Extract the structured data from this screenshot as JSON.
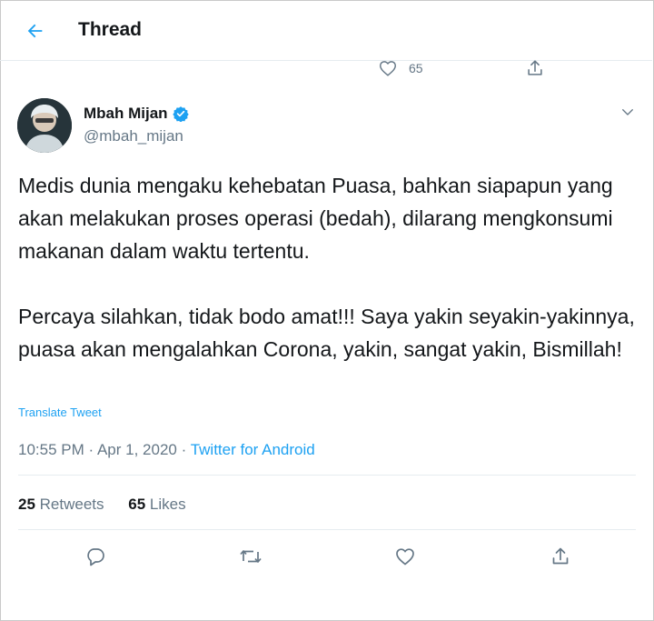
{
  "header": {
    "title": "Thread"
  },
  "previous_tweet": {
    "like_count": "65"
  },
  "tweet": {
    "author_name": "Mbah Mijan",
    "author_handle": "@mbah_mijan",
    "paragraphs": [
      "Medis dunia mengaku kehebatan Puasa, bahkan siapapun yang akan melakukan proses operasi (bedah), dilarang mengkonsumi makanan dalam waktu tertentu.",
      "Percaya silahkan, tidak bodo amat!!! Saya yakin seyakin-yakinnya, puasa akan mengalahkan Corona, yakin, sangat yakin, Bismillah!"
    ],
    "translate_label": "Translate Tweet",
    "time": "10:55 PM",
    "date": "Apr 1, 2020",
    "separator": "·",
    "source": "Twitter for Android",
    "retweet_count": "25",
    "retweet_label": "Retweets",
    "like_count": "65",
    "like_label": "Likes"
  },
  "colors": {
    "accent": "#1da1f2",
    "text": "#14171a",
    "muted": "#657786",
    "divider": "#e6ecf0"
  },
  "icons": [
    "back-arrow-icon",
    "heart-icon",
    "share-icon",
    "verified-badge-icon",
    "chevron-down-icon",
    "reply-icon",
    "retweet-icon"
  ]
}
